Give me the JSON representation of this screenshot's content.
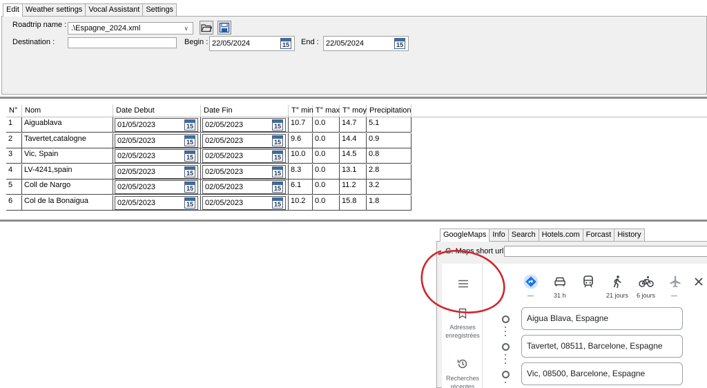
{
  "top_tabs": [
    "Edit",
    "Weather settings",
    "Vocal Assistant",
    "Settings"
  ],
  "edit": {
    "roadtrip_label": "Roadtrip name :",
    "roadtrip_value": ".\\Espagne_2024.xml",
    "destination_label": "Destination :",
    "destination_value": "",
    "begin_label": "Begin :",
    "begin_value": "22/05/2024",
    "end_label": "End :",
    "end_value": "22/05/2024"
  },
  "calendar_icon_text": "15",
  "grid": {
    "columns": [
      "N°",
      "Nom",
      "Date Debut",
      "Date Fin",
      "T° min",
      "T° max",
      "T° moy",
      "Precipitation"
    ],
    "rows": [
      {
        "n": "1",
        "nom": "Aiguablava",
        "debut": "01/05/2023",
        "fin": "02/05/2023",
        "tmin": "10.7",
        "tmax": "0.0",
        "tmoy": "14.7",
        "precip": "5.1"
      },
      {
        "n": "2",
        "nom": "Tavertet,catalogne",
        "debut": "02/05/2023",
        "fin": "02/05/2023",
        "tmin": "9.6",
        "tmax": "0.0",
        "tmoy": "14.4",
        "precip": "0.9"
      },
      {
        "n": "3",
        "nom": "Vic, Spain",
        "debut": "02/05/2023",
        "fin": "02/05/2023",
        "tmin": "10.0",
        "tmax": "0.0",
        "tmoy": "14.5",
        "precip": "0.8"
      },
      {
        "n": "4",
        "nom": "LV-4241,spain",
        "debut": "02/05/2023",
        "fin": "02/05/2023",
        "tmin": "8.3",
        "tmax": "0.0",
        "tmoy": "13.1",
        "precip": "2.8"
      },
      {
        "n": "5",
        "nom": "Coll de Nargo",
        "debut": "02/05/2023",
        "fin": "02/05/2023",
        "tmin": "6.1",
        "tmax": "0.0",
        "tmoy": "11.2",
        "precip": "3.2"
      },
      {
        "n": "6",
        "nom": "Col de la Bonaigua",
        "debut": "02/05/2023",
        "fin": "02/05/2023",
        "tmin": "10.2",
        "tmax": "0.0",
        "tmoy": "15.8",
        "precip": "1.8"
      }
    ]
  },
  "bottom_tabs": [
    "GoogleMaps",
    "Info",
    "Search",
    "Hotels.com",
    "Forcast",
    "History"
  ],
  "maps": {
    "short_url_label": "G. Maps short url :",
    "short_url_value": "",
    "sidebar": {
      "saved_line1": "Adresses",
      "saved_line2": "enregistrées",
      "recent_line1": "Recherches",
      "recent_line2": "récentes"
    },
    "modes": [
      {
        "icon": "directions-icon",
        "label": "—"
      },
      {
        "icon": "car-icon",
        "label": "31 h"
      },
      {
        "icon": "transit-icon",
        "label": ""
      },
      {
        "icon": "walk-icon",
        "label": "21 jours"
      },
      {
        "icon": "bike-icon",
        "label": "6 jours"
      },
      {
        "icon": "plane-icon",
        "label": "—"
      }
    ],
    "route": [
      "Aigua Blava, Espagne",
      "Tavertet, 08511, Barcelone, Espagne",
      "Vic, 08500, Barcelone, Espagne"
    ]
  },
  "colors": {
    "annotation_circle": "#d0252a",
    "google_blue": "#1a73e8"
  }
}
